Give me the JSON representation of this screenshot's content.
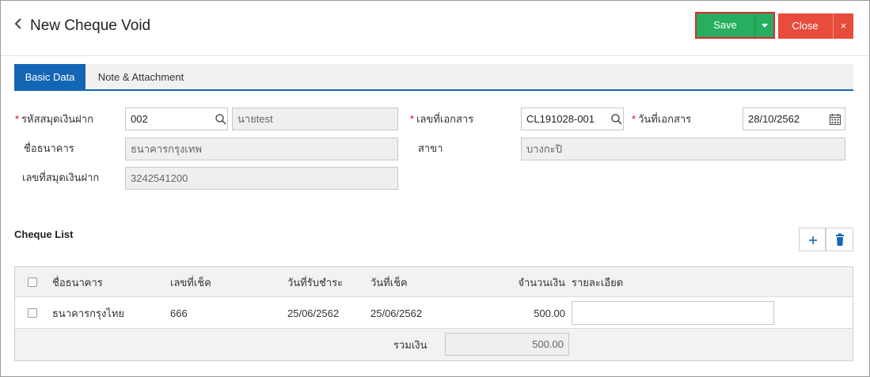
{
  "header": {
    "back_icon": "chevron-left-icon",
    "title": "New Cheque Void",
    "save_label": "Save",
    "close_label": "Close",
    "close_x": "×"
  },
  "colors": {
    "save": "#27ae60",
    "save_outline": "#e02a2a",
    "close": "#e74c3c",
    "tab_active": "#1366b4"
  },
  "tabs": [
    {
      "label": "Basic Data",
      "active": true
    },
    {
      "label": "Note & Attachment",
      "active": false
    }
  ],
  "form": {
    "account_code": {
      "label": "รหัสสมุดเงินฝาก",
      "required": true,
      "value": "002",
      "name_value": "นายtest"
    },
    "bank_name": {
      "label": "ชื่อธนาคาร",
      "value": "ธนาคารกรุงเทพ"
    },
    "account_number": {
      "label": "เลขที่สมุดเงินฝาก",
      "value": "3242541200"
    },
    "doc_number": {
      "label": "เลขที่เอกสาร",
      "required": true,
      "value": "CL191028-001"
    },
    "doc_date": {
      "label": "วันที่เอกสาร",
      "required": true,
      "value": "28/10/2562"
    },
    "branch": {
      "label": "สาขา",
      "value": "บางกะปิ"
    }
  },
  "cheque_list": {
    "title": "Cheque List",
    "add_icon": "plus-icon",
    "delete_icon": "trash-icon",
    "columns": [
      "ชื่อธนาคาร",
      "เลขที่เช็ค",
      "วันที่รับชำระ",
      "วันที่เช็ค",
      "จำนวนเงิน",
      "รายละเอียด"
    ],
    "rows": [
      {
        "bank": "ธนาคารกรุงไทย",
        "cheque_no": "666",
        "received_date": "25/06/2562",
        "cheque_date": "25/06/2562",
        "amount": "500.00",
        "detail": ""
      }
    ],
    "total_label": "รวมเงิน",
    "total_value": "500.00"
  }
}
